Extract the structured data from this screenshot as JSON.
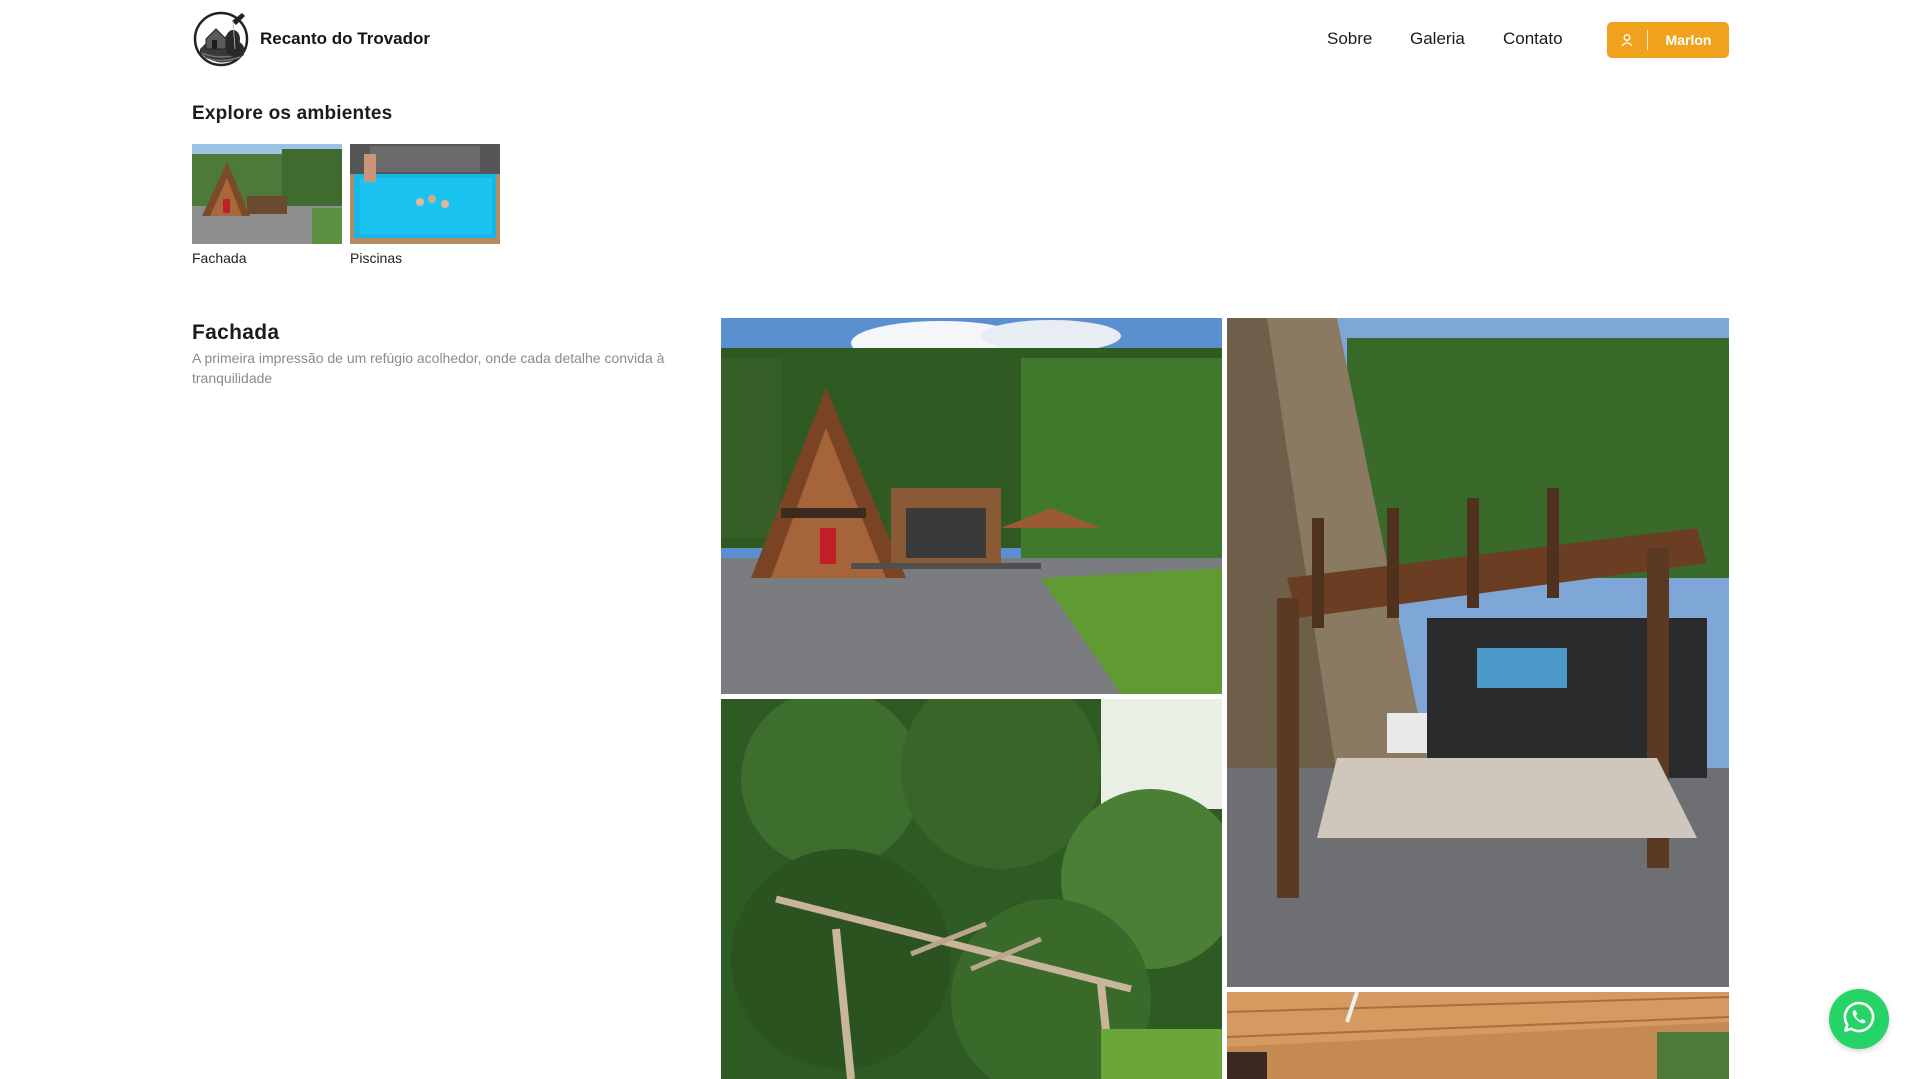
{
  "header": {
    "brand_name": "Recanto do Trovador",
    "logo_icon": "guitar-house-logo",
    "nav": [
      {
        "label": "Sobre"
      },
      {
        "label": "Galeria"
      },
      {
        "label": "Contato"
      }
    ],
    "user_button": {
      "icon": "user-icon",
      "label": "Marlon",
      "color": "#f0a21e"
    }
  },
  "explore": {
    "title": "Explore os ambientes",
    "items": [
      {
        "label": "Fachada",
        "image": "a-frame-chalet-photo"
      },
      {
        "label": "Piscinas",
        "image": "pool-photo"
      }
    ]
  },
  "section": {
    "title": "Fachada",
    "description": "A primeira impressão de um refúgio acolhedor, onde cada detalhe convida à tranquilidade"
  },
  "gallery": [
    {
      "image": "a-frame-chalet-exterior-photo"
    },
    {
      "image": "garden-trees-pergola-photo"
    },
    {
      "image": "wooden-pergola-entrance-photo"
    },
    {
      "image": "wooden-ceiling-photo"
    }
  ],
  "whatsapp": {
    "icon": "whatsapp-icon",
    "color": "#25d366"
  }
}
